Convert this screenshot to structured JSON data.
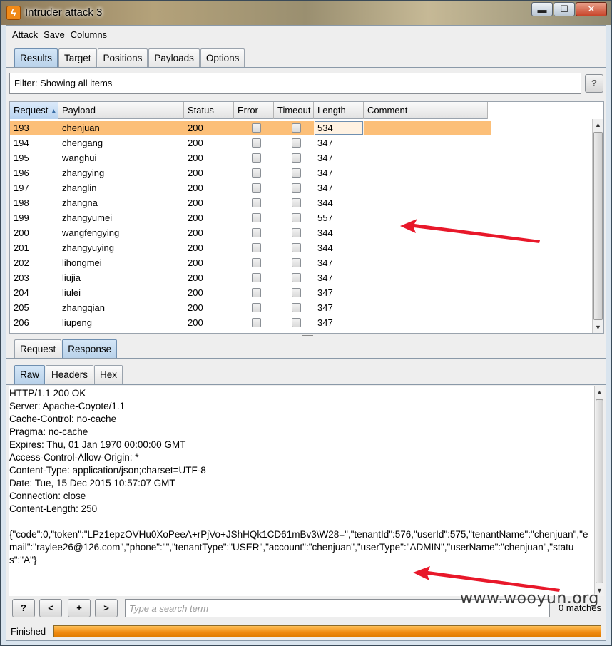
{
  "window": {
    "title": "Intruder attack 3",
    "minimize": "▬",
    "maximize": "☐",
    "close": "✕"
  },
  "menu": [
    "Attack",
    "Save",
    "Columns"
  ],
  "main_tabs": [
    "Results",
    "Target",
    "Positions",
    "Payloads",
    "Options"
  ],
  "filter": {
    "text": "Filter: Showing all items",
    "help": "?"
  },
  "table": {
    "columns": [
      "Request",
      "Payload",
      "Status",
      "Error",
      "Timeout",
      "Length",
      "Comment"
    ],
    "sorted_column": "Request",
    "rows": [
      {
        "request": "193",
        "payload": "chenjuan",
        "status": "200",
        "error": false,
        "timeout": false,
        "length": "534",
        "comment": "",
        "selected": true
      },
      {
        "request": "194",
        "payload": "chengang",
        "status": "200",
        "error": false,
        "timeout": false,
        "length": "347",
        "comment": ""
      },
      {
        "request": "195",
        "payload": "wanghui",
        "status": "200",
        "error": false,
        "timeout": false,
        "length": "347",
        "comment": ""
      },
      {
        "request": "196",
        "payload": "zhangying",
        "status": "200",
        "error": false,
        "timeout": false,
        "length": "347",
        "comment": ""
      },
      {
        "request": "197",
        "payload": "zhanglin",
        "status": "200",
        "error": false,
        "timeout": false,
        "length": "347",
        "comment": ""
      },
      {
        "request": "198",
        "payload": "zhangna",
        "status": "200",
        "error": false,
        "timeout": false,
        "length": "344",
        "comment": ""
      },
      {
        "request": "199",
        "payload": "zhangyumei",
        "status": "200",
        "error": false,
        "timeout": false,
        "length": "557",
        "comment": ""
      },
      {
        "request": "200",
        "payload": "wangfengying",
        "status": "200",
        "error": false,
        "timeout": false,
        "length": "344",
        "comment": ""
      },
      {
        "request": "201",
        "payload": "zhangyuying",
        "status": "200",
        "error": false,
        "timeout": false,
        "length": "344",
        "comment": ""
      },
      {
        "request": "202",
        "payload": "lihongmei",
        "status": "200",
        "error": false,
        "timeout": false,
        "length": "347",
        "comment": ""
      },
      {
        "request": "203",
        "payload": "liujia",
        "status": "200",
        "error": false,
        "timeout": false,
        "length": "347",
        "comment": ""
      },
      {
        "request": "204",
        "payload": "liulei",
        "status": "200",
        "error": false,
        "timeout": false,
        "length": "347",
        "comment": ""
      },
      {
        "request": "205",
        "payload": "zhangqian",
        "status": "200",
        "error": false,
        "timeout": false,
        "length": "347",
        "comment": ""
      },
      {
        "request": "206",
        "payload": "liupeng",
        "status": "200",
        "error": false,
        "timeout": false,
        "length": "347",
        "comment": ""
      }
    ]
  },
  "detail_tabs": [
    "Request",
    "Response"
  ],
  "view_tabs": [
    "Raw",
    "Headers",
    "Hex"
  ],
  "response": {
    "headers": [
      "HTTP/1.1 200 OK",
      "Server: Apache-Coyote/1.1",
      "Cache-Control: no-cache",
      "Pragma: no-cache",
      "Expires: Thu, 01 Jan 1970 00:00:00 GMT",
      "Access-Control-Allow-Origin: *",
      "Content-Type: application/json;charset=UTF-8",
      "Date: Tue, 15 Dec 2015 10:57:07 GMT",
      "Connection: close",
      "Content-Length: 250"
    ],
    "body": "{\"code\":0,\"token\":\"LPz1epzOVHu0XoPeeA+rPjVo+JShHQk1CD61mBv3\\W28=\",\"tenantId\":576,\"userId\":575,\"tenantName\":\"chenjuan\",\"email\":\"raylee26@126.com\",\"phone\":\"\",\"tenantType\":\"USER\",\"account\":\"chenjuan\",\"userType\":\"ADMIN\",\"userName\":\"chenjuan\",\"status\":\"A\"}"
  },
  "search": {
    "help": "?",
    "prev": "<",
    "add": "+",
    "next": ">",
    "placeholder": "Type a search term",
    "matches": "0 matches"
  },
  "status": {
    "text": "Finished",
    "progress": 1.0
  },
  "watermark": "www.wooyun.org",
  "colors": {
    "selected_row": "#fcbf78",
    "progress": "#f08a10",
    "annotation_arrow": "#e8182a",
    "active_tab": "#c4dbf1"
  }
}
